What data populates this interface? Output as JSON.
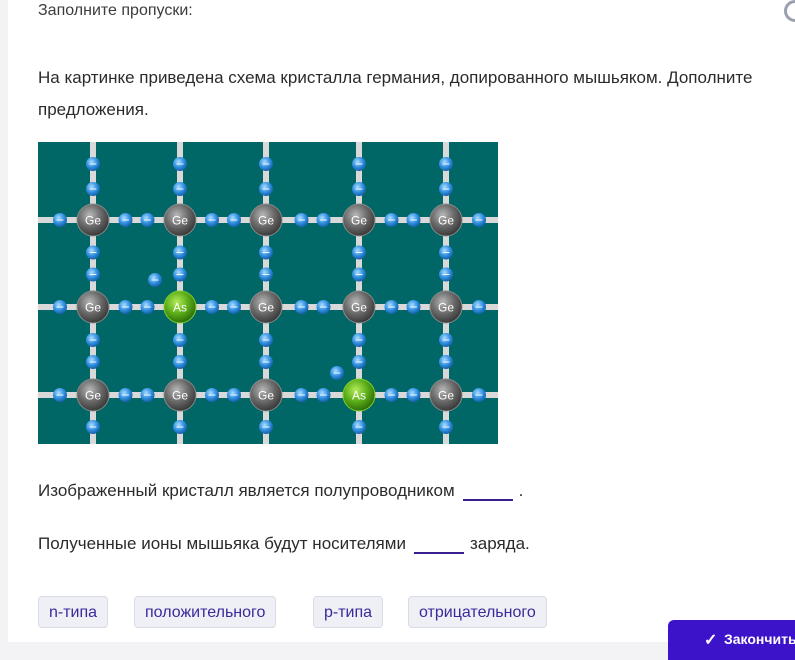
{
  "instruction": "Заполните пропуски:",
  "question": "На картинке приведена схема кристалла германия, допированного мышьяком. Дополните предложения.",
  "figure": {
    "rows": [
      [
        "Ge",
        "Ge",
        "Ge",
        "Ge",
        "Ge"
      ],
      [
        "Ge",
        "As",
        "Ge",
        "Ge",
        "Ge"
      ],
      [
        "Ge",
        "Ge",
        "Ge",
        "As",
        "Ge"
      ]
    ],
    "electron_symbol": "−",
    "colors": {
      "background": "#006666",
      "bond": "#d9d9d9",
      "germanium": "#5a5a5a",
      "arsenic": "#5cae1a",
      "electron": "#2f8fe0"
    }
  },
  "sentences": [
    {
      "before": "Изображенный кристалл является полупроводником",
      "after": "."
    },
    {
      "before": "Полученные ионы мышьяка будут носителями",
      "after": "заряда."
    }
  ],
  "options": [
    "n-типа",
    "положительного",
    "p-типа",
    "отрицательного"
  ],
  "finish_button": {
    "label": "Закончить",
    "icon": "check-icon"
  },
  "accent_color": "#3d13c9"
}
